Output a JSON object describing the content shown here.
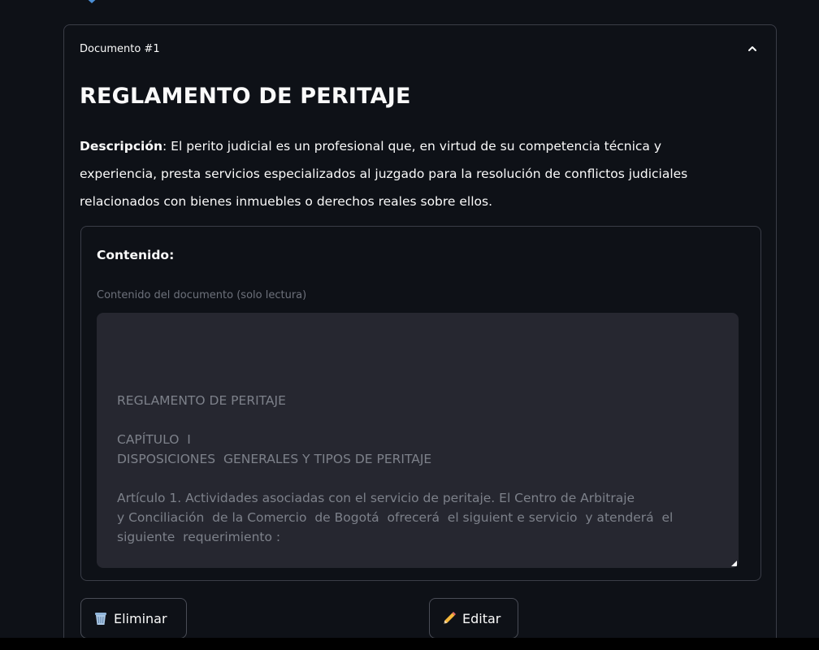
{
  "expander": {
    "label": "Documento #1",
    "expanded": true,
    "chevron_icon": "chevron-up-icon"
  },
  "document": {
    "title": "REGLAMENTO DE PERITAJE",
    "description_label": "Descripción",
    "description_text": ": El perito judicial es un profesional que, en virtud de su competencia técnica y experiencia, presta servicios especializados al juzgado para la resolución de conflictos judiciales relacionados con bienes inmuebles o derechos reales sobre ellos."
  },
  "content": {
    "heading": "Contenido:",
    "field_label": "Contenido del documento (solo lectura)",
    "lines": [
      "",
      "",
      "",
      "",
      "REGLAMENTO DE PERITAJE",
      "",
      "CAPÍTULO  I",
      "DISPOSICIONES  GENERALES Y TIPOS DE PERITAJE",
      "",
      "Artículo 1. Actividades asociadas con el servicio de peritaje. El Centro de Arbitraje",
      "y Conciliación  de la Comercio  de Bogotá  ofrecerá  el siguient e servicio  y atenderá  el",
      "siguiente  requerimiento :"
    ]
  },
  "buttons": {
    "delete_label": "Eliminar",
    "delete_icon": "wastebasket-icon",
    "edit_label": "Editar",
    "edit_icon": "pencil-icon"
  },
  "colors": {
    "background": "#0e1117",
    "text": "#fafafa",
    "muted_text": "#7d818a",
    "border": "#3a3d47",
    "textarea_bg": "#262730"
  }
}
